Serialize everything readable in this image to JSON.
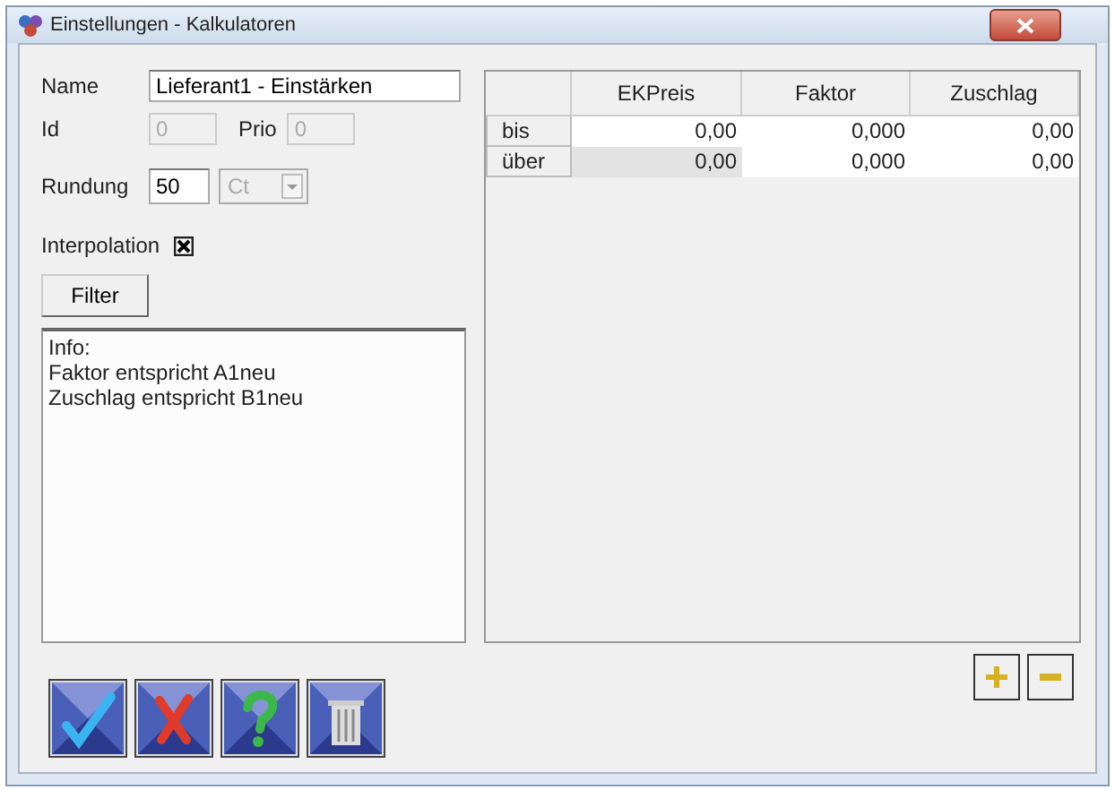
{
  "window": {
    "title": "Einstellungen - Kalkulatoren"
  },
  "name": {
    "label": "Name",
    "value": "Lieferant1 - Einstärken"
  },
  "id": {
    "label": "Id",
    "value": "0",
    "disabled": true
  },
  "prio": {
    "label": "Prio",
    "value": "0",
    "disabled": true
  },
  "rundung": {
    "label": "Rundung",
    "value": "50",
    "disabled": false
  },
  "unit": {
    "value": "Ct",
    "disabled": true
  },
  "interpolation": {
    "label": "Interpolation",
    "checked": true
  },
  "filter_button": "Filter",
  "info": {
    "lines": [
      "Info:",
      "Faktor entspricht A1neu",
      "Zuschlag entspricht B1neu"
    ]
  },
  "table": {
    "columns": [
      "EKPreis",
      "Faktor",
      "Zuschlag"
    ],
    "rows": [
      {
        "label": "bis",
        "cells": [
          {
            "value": "0,00",
            "selected": false
          },
          {
            "value": "0,000",
            "selected": false
          },
          {
            "value": "0,00",
            "selected": false
          }
        ]
      },
      {
        "label": "über",
        "cells": [
          {
            "value": "0,00",
            "selected": true
          },
          {
            "value": "0,000",
            "selected": false
          },
          {
            "value": "0,00",
            "selected": false
          }
        ]
      }
    ]
  },
  "row_buttons": [
    {
      "kind": "add"
    },
    {
      "kind": "remove"
    }
  ],
  "action_buttons": [
    {
      "kind": "confirm"
    },
    {
      "kind": "cancel"
    },
    {
      "kind": "help"
    },
    {
      "kind": "delete"
    }
  ]
}
